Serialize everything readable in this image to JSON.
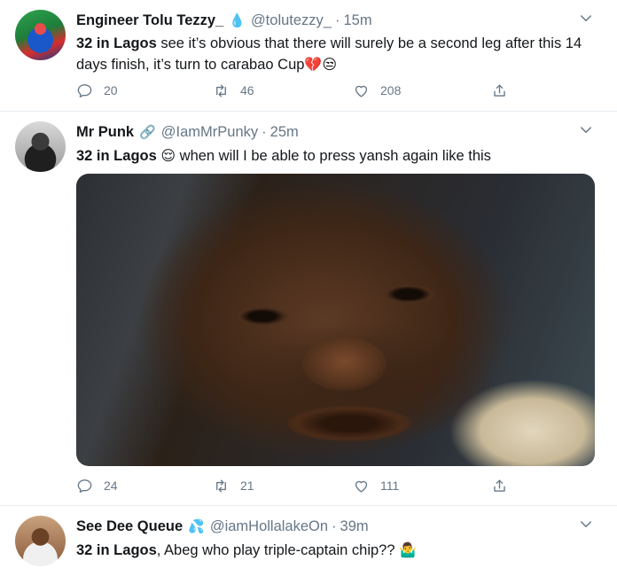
{
  "tweets": [
    {
      "name": "Engineer Tolu Tezzy_",
      "badge": "💧",
      "handle": "@tolutezzy_",
      "separator": "·",
      "time": "15m",
      "lead": "32 in Lagos",
      "body": " see it’s obvious that there will surely be a second leg after this 14 days finish, it’s turn to carabao Cup",
      "emojis": "💔😒",
      "replies": "20",
      "retweets": "46",
      "likes": "208"
    },
    {
      "name": "Mr Punk",
      "badge": "🔗",
      "handle": "@IamMrPunky",
      "separator": "·",
      "time": "25m",
      "lead": "32 in Lagos",
      "emoji_mid": "😌",
      "body": " when will I be able to press yansh again like this",
      "photo_alt": "close-up photo of a man with a tear on his cheek",
      "replies": "24",
      "retweets": "21",
      "likes": "111"
    },
    {
      "name": "See Dee Queue",
      "badge": "💦",
      "handle": "@iamHollalakeOn",
      "separator": "·",
      "time": "39m",
      "lead": "32 in Lagos",
      "body": ", Abeg who play triple-captain chip??",
      "emojis": "🤷‍♂️"
    }
  ],
  "icons": {
    "reply": "reply-icon",
    "retweet": "retweet-icon",
    "like": "like-icon",
    "share": "share-icon",
    "chevron": "chevron-down-icon"
  },
  "colors": {
    "text": "#14171a",
    "secondary": "#657786",
    "divider": "#e6ecf0"
  }
}
